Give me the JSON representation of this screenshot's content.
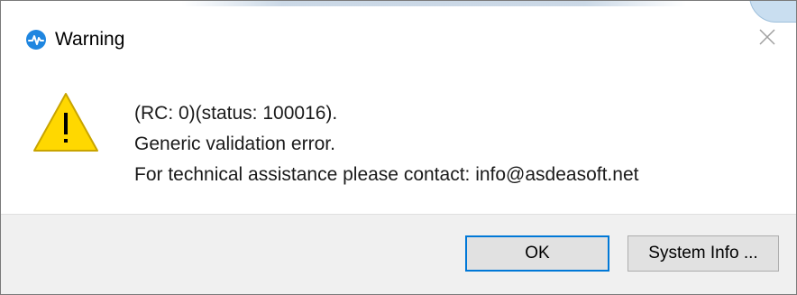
{
  "dialog": {
    "title": "Warning",
    "icons": {
      "app": "app-pulse-icon",
      "close": "close-icon",
      "warning": "warning-triangle-icon"
    },
    "message": {
      "line1": "(RC: 0)(status: 100016).",
      "line2": "Generic validation error.",
      "line3": "For technical assistance please contact: info@asdeasoft.net"
    },
    "buttons": {
      "ok_label": "OK",
      "system_info_label": "System Info ..."
    }
  },
  "colors": {
    "accent": "#0078d7",
    "warning_fill": "#ffd800",
    "footer_bg": "#f0f0f0",
    "app_icon": "#1f86e0"
  }
}
